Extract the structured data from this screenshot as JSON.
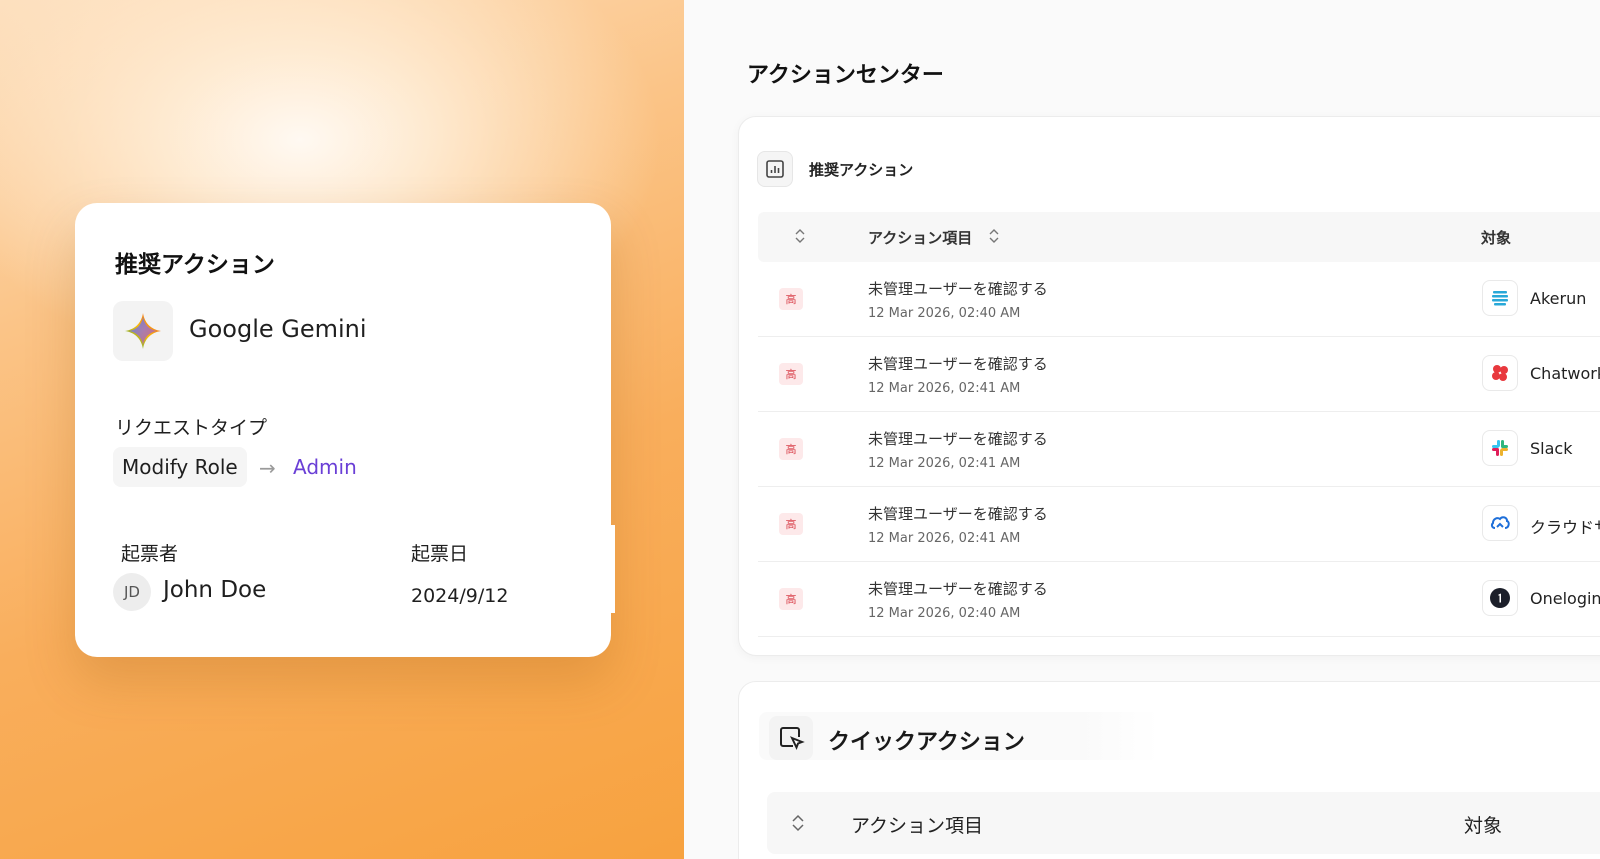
{
  "request_card": {
    "title": "推奨アクション",
    "app_name": "Google Gemini",
    "request_type_label": "リクエストタイプ",
    "from_role": "Modify Role",
    "to_role": "Admin",
    "submitter_label": "起票者",
    "submit_date_label": "起票日",
    "avatar_initials": "JD",
    "submitter_name": "John Doe",
    "submit_date": "2024/9/12"
  },
  "action_center": {
    "title": "アクションセンター",
    "recommended_panel": {
      "title": "推奨アクション",
      "columns": {
        "item": "アクション項目",
        "target": "対象"
      },
      "rows": [
        {
          "priority": "高",
          "title": "未管理ユーザーを確認する",
          "time": "12 Mar 2026, 02:40 AM",
          "app": "Akerun",
          "icon": "akerun-icon"
        },
        {
          "priority": "高",
          "title": "未管理ユーザーを確認する",
          "time": "12 Mar 2026, 02:41 AM",
          "app": "Chatwork",
          "icon": "chatwork-icon"
        },
        {
          "priority": "高",
          "title": "未管理ユーザーを確認する",
          "time": "12 Mar 2026, 02:41 AM",
          "app": "Slack",
          "icon": "slack-icon"
        },
        {
          "priority": "高",
          "title": "未管理ユーザーを確認する",
          "time": "12 Mar 2026, 02:41 AM",
          "app": "クラウドサ",
          "icon": "cloud-icon"
        },
        {
          "priority": "高",
          "title": "未管理ユーザーを確認する",
          "time": "12 Mar 2026, 02:40 AM",
          "app": "Onelogin",
          "icon": "onelogin-icon"
        }
      ]
    },
    "quick_panel": {
      "title": "クイックアクション",
      "columns": {
        "item": "アクション項目",
        "target": "対象"
      }
    }
  },
  "colors": {
    "accent_purple": "#6a3fd6",
    "priority_red": "#d9424c",
    "priority_bg": "#fde9ea",
    "gradient_orange": "#f7a23f"
  }
}
